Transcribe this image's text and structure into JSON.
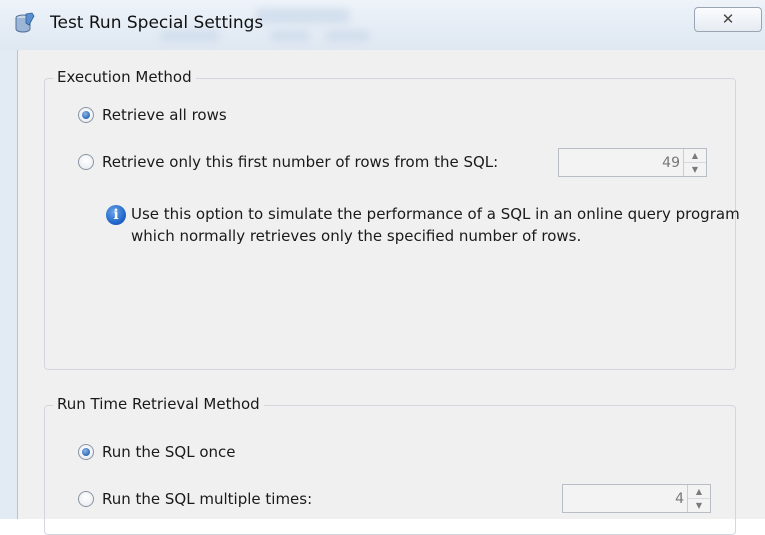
{
  "window": {
    "title": "Test Run Special Settings",
    "close_glyph": "✕"
  },
  "execution_method": {
    "label": "Execution Method",
    "options": [
      {
        "label": "Retrieve all rows",
        "checked": true
      },
      {
        "label": "Retrieve only this first number of rows from the SQL:",
        "checked": false
      }
    ],
    "rows_value": "49",
    "info_lines": [
      "Use this option to simulate the performance of a SQL in an online query program",
      "which normally retrieves only the specified number of rows."
    ]
  },
  "run_time_retrieval": {
    "label": "Run Time Retrieval Method",
    "options": [
      {
        "label": "Run the SQL once",
        "checked": true
      },
      {
        "label": "Run the SQL multiple times:",
        "checked": false
      }
    ],
    "times_value": "4"
  },
  "icons": {
    "app": "database-wrench-icon",
    "info": "info-icon",
    "close": "close-icon",
    "spin_up": "chevron-up-icon",
    "spin_down": "chevron-down-icon"
  }
}
